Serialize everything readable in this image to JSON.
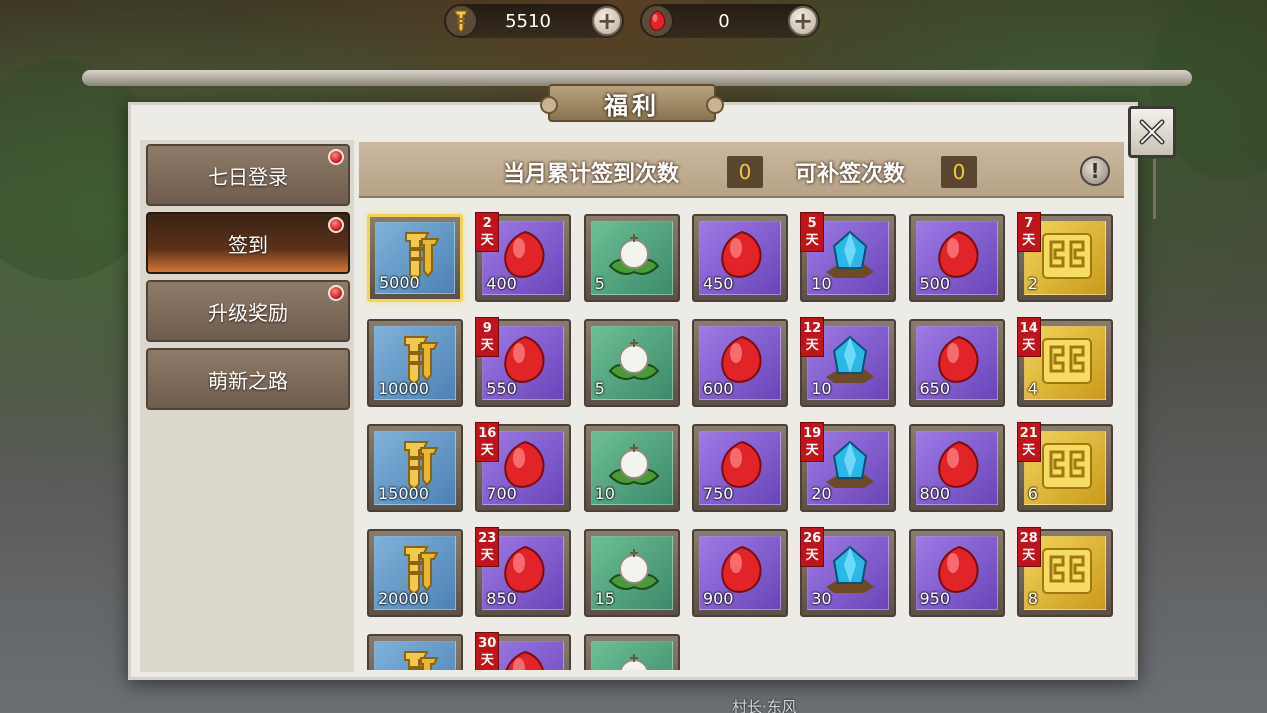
{
  "currency": {
    "coin": {
      "icon": "coin-ticket-icon",
      "value": "5510"
    },
    "gem": {
      "icon": "red-gem-icon",
      "value": "0"
    }
  },
  "panel": {
    "title": "福利"
  },
  "sidebar": {
    "items": [
      {
        "label": "七日登录",
        "active": false,
        "badge": true
      },
      {
        "label": "签到",
        "active": true,
        "badge": true
      },
      {
        "label": "升级奖励",
        "active": false,
        "badge": true
      },
      {
        "label": "萌新之路",
        "active": false,
        "badge": false
      }
    ]
  },
  "info_bar": {
    "monthly_label": "当月累计签到次数",
    "monthly_count": "0",
    "makeup_label": "可补签次数",
    "makeup_count": "0",
    "info_icon": "exclamation-icon"
  },
  "rewards": [
    {
      "type": "coin",
      "qty": "5000",
      "day": "",
      "selected": true
    },
    {
      "type": "gem",
      "qty": "400",
      "day": "2"
    },
    {
      "type": "bun",
      "qty": "5",
      "day": ""
    },
    {
      "type": "gem",
      "qty": "450",
      "day": ""
    },
    {
      "type": "crystal",
      "qty": "10",
      "day": "5"
    },
    {
      "type": "gem",
      "qty": "500",
      "day": ""
    },
    {
      "type": "gold",
      "qty": "2",
      "day": "7"
    },
    {
      "type": "coin",
      "qty": "10000",
      "day": ""
    },
    {
      "type": "gem",
      "qty": "550",
      "day": "9"
    },
    {
      "type": "bun",
      "qty": "5",
      "day": ""
    },
    {
      "type": "gem",
      "qty": "600",
      "day": ""
    },
    {
      "type": "crystal",
      "qty": "10",
      "day": "12"
    },
    {
      "type": "gem",
      "qty": "650",
      "day": ""
    },
    {
      "type": "gold",
      "qty": "4",
      "day": "14"
    },
    {
      "type": "coin",
      "qty": "15000",
      "day": ""
    },
    {
      "type": "gem",
      "qty": "700",
      "day": "16"
    },
    {
      "type": "bun",
      "qty": "10",
      "day": ""
    },
    {
      "type": "gem",
      "qty": "750",
      "day": ""
    },
    {
      "type": "crystal",
      "qty": "20",
      "day": "19"
    },
    {
      "type": "gem",
      "qty": "800",
      "day": ""
    },
    {
      "type": "gold",
      "qty": "6",
      "day": "21"
    },
    {
      "type": "coin",
      "qty": "20000",
      "day": ""
    },
    {
      "type": "gem",
      "qty": "850",
      "day": "23"
    },
    {
      "type": "bun",
      "qty": "15",
      "day": ""
    },
    {
      "type": "gem",
      "qty": "900",
      "day": ""
    },
    {
      "type": "crystal",
      "qty": "30",
      "day": "26"
    },
    {
      "type": "gem",
      "qty": "950",
      "day": ""
    },
    {
      "type": "gold",
      "qty": "8",
      "day": "28"
    },
    {
      "type": "coin",
      "qty": "",
      "day": ""
    },
    {
      "type": "gem",
      "qty": "",
      "day": "30"
    },
    {
      "type": "bun",
      "qty": "",
      "day": ""
    }
  ],
  "day_suffix": "天",
  "footer": {
    "npc_label": "村长·东风"
  }
}
